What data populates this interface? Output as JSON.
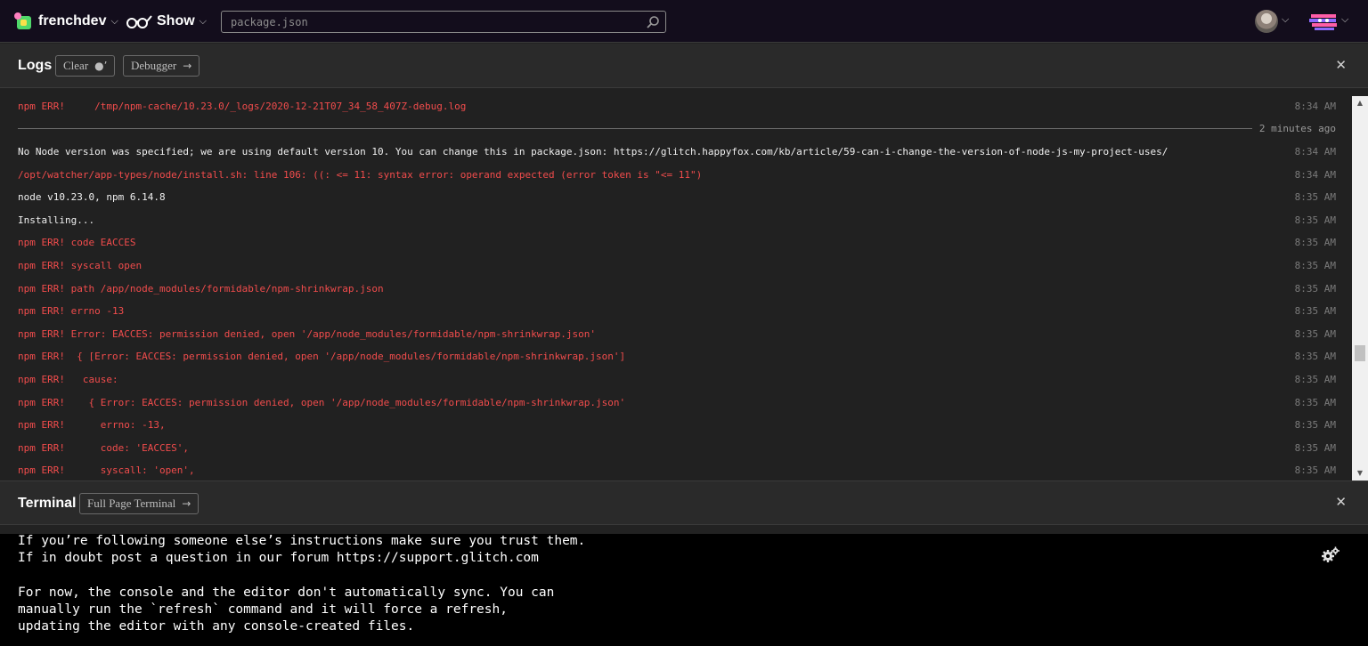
{
  "topbar": {
    "project_name": "frenchdev",
    "show_label": "Show",
    "search_placeholder": "package.json"
  },
  "logs": {
    "title": "Logs",
    "clear_label": "Clear",
    "debugger_label": "Debugger",
    "divider_label": "2 minutes ago",
    "entries": [
      {
        "msg": "npm ERR!     /tmp/npm-cache/10.23.0/_logs/2020-12-21T07_34_58_407Z-debug.log",
        "time": "8:34 AM",
        "level": "error"
      },
      {
        "msg": "No Node version was specified; we are using default version 10. You can change this in package.json: https://glitch.happyfox.com/kb/article/59-can-i-change-the-version-of-node-js-my-project-uses/",
        "time": "8:34 AM",
        "level": "info"
      },
      {
        "msg": "/opt/watcher/app-types/node/install.sh: line 106: ((: <= 11: syntax error: operand expected (error token is \"<= 11\")",
        "time": "8:34 AM",
        "level": "error"
      },
      {
        "msg": "node v10.23.0, npm 6.14.8",
        "time": "8:35 AM",
        "level": "info"
      },
      {
        "msg": "Installing...",
        "time": "8:35 AM",
        "level": "info"
      },
      {
        "msg": "npm ERR! code EACCES",
        "time": "8:35 AM",
        "level": "error"
      },
      {
        "msg": "npm ERR! syscall open",
        "time": "8:35 AM",
        "level": "error"
      },
      {
        "msg": "npm ERR! path /app/node_modules/formidable/npm-shrinkwrap.json",
        "time": "8:35 AM",
        "level": "error"
      },
      {
        "msg": "npm ERR! errno -13",
        "time": "8:35 AM",
        "level": "error"
      },
      {
        "msg": "npm ERR! Error: EACCES: permission denied, open '/app/node_modules/formidable/npm-shrinkwrap.json'",
        "time": "8:35 AM",
        "level": "error"
      },
      {
        "msg": "npm ERR!  { [Error: EACCES: permission denied, open '/app/node_modules/formidable/npm-shrinkwrap.json']",
        "time": "8:35 AM",
        "level": "error"
      },
      {
        "msg": "npm ERR!   cause:",
        "time": "8:35 AM",
        "level": "error"
      },
      {
        "msg": "npm ERR!    { Error: EACCES: permission denied, open '/app/node_modules/formidable/npm-shrinkwrap.json'",
        "time": "8:35 AM",
        "level": "error"
      },
      {
        "msg": "npm ERR!      errno: -13,",
        "time": "8:35 AM",
        "level": "error"
      },
      {
        "msg": "npm ERR!      code: 'EACCES',",
        "time": "8:35 AM",
        "level": "error"
      },
      {
        "msg": "npm ERR!      syscall: 'open',",
        "time": "8:35 AM",
        "level": "error"
      }
    ]
  },
  "terminal": {
    "title": "Terminal",
    "full_page_label": "Full Page Terminal",
    "lines": [
      "If you’re following someone else’s instructions make sure you trust them.",
      "If in doubt post a question in our forum https://support.glitch.com",
      "",
      "For now, the console and the editor don't automatically sync. You can",
      "manually run the `refresh` command and it will force a refresh,",
      "updating the editor with any console-created files."
    ]
  },
  "icons": {
    "close": "close-icon",
    "settings": "gear-icon",
    "search": "search-icon"
  },
  "colors": {
    "error": "#f14c4c",
    "info": "#f0f0f0",
    "topbar_bg": "#130d1c",
    "terminal_bg": "#000000"
  }
}
